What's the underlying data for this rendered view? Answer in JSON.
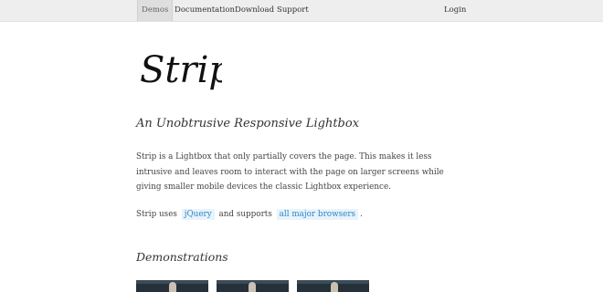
{
  "nav": {
    "demos": "Demos",
    "documentation": "Documentation",
    "download": "Download",
    "support": "Support",
    "login": "Login"
  },
  "logo_text": "Strip",
  "subtitle": "An Unobtrusive Responsive Lightbox",
  "intro": "Strip is a Lightbox that only partially covers the page. This makes it less intrusive and leaves room to interact with the page on larger screens while giving smaller mobile devices the classic Lightbox experience.",
  "uses": {
    "prefix": "Strip uses",
    "jquery": "jQuery",
    "middle": "and supports",
    "browsers": "all major browsers",
    "suffix": "."
  },
  "demonstrations_title": "Demonstrations",
  "colors": {
    "link": "#2a88c8",
    "link_bg": "#e8f3fb",
    "topbar": "#eeeeee"
  }
}
